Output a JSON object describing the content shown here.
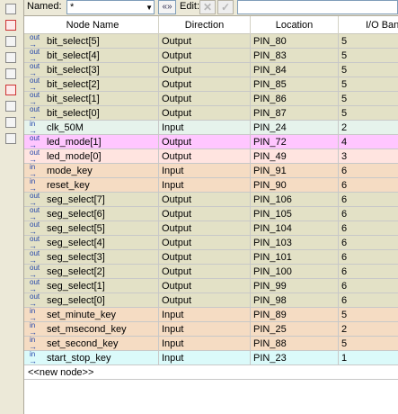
{
  "toolbar": {
    "named_label": "Named:",
    "named_value": "*",
    "combo_arrow": "▼",
    "expand_glyph": "«»",
    "edit_label": "Edit:",
    "x_glyph": "✕",
    "check_glyph": "✓"
  },
  "columns": [
    "Node Name",
    "Direction",
    "Location",
    "I/O Bank"
  ],
  "colors": {
    "output_row": "#e3e1c6",
    "input_row": "#f5dcc3",
    "selected_row": "#ffc6ff",
    "led_row": "#ffe4e0",
    "clk_row": "#e6f3ec",
    "last_row": "#dbfafa"
  },
  "rows": [
    {
      "dir_icon": "out",
      "name": "bit_select[5]",
      "direction": "Output",
      "location": "PIN_80",
      "bank": "5"
    },
    {
      "dir_icon": "out",
      "name": "bit_select[4]",
      "direction": "Output",
      "location": "PIN_83",
      "bank": "5"
    },
    {
      "dir_icon": "out",
      "name": "bit_select[3]",
      "direction": "Output",
      "location": "PIN_84",
      "bank": "5"
    },
    {
      "dir_icon": "out",
      "name": "bit_select[2]",
      "direction": "Output",
      "location": "PIN_85",
      "bank": "5"
    },
    {
      "dir_icon": "out",
      "name": "bit_select[1]",
      "direction": "Output",
      "location": "PIN_86",
      "bank": "5"
    },
    {
      "dir_icon": "out",
      "name": "bit_select[0]",
      "direction": "Output",
      "location": "PIN_87",
      "bank": "5"
    },
    {
      "dir_icon": "in",
      "name": "clk_50M",
      "direction": "Input",
      "location": "PIN_24",
      "bank": "2"
    },
    {
      "dir_icon": "out",
      "name": "led_mode[1]",
      "direction": "Output",
      "location": "PIN_72",
      "bank": "4"
    },
    {
      "dir_icon": "out",
      "name": "led_mode[0]",
      "direction": "Output",
      "location": "PIN_49",
      "bank": "3"
    },
    {
      "dir_icon": "in",
      "name": "mode_key",
      "direction": "Input",
      "location": "PIN_91",
      "bank": "6"
    },
    {
      "dir_icon": "in",
      "name": "reset_key",
      "direction": "Input",
      "location": "PIN_90",
      "bank": "6"
    },
    {
      "dir_icon": "out",
      "name": "seg_select[7]",
      "direction": "Output",
      "location": "PIN_106",
      "bank": "6"
    },
    {
      "dir_icon": "out",
      "name": "seg_select[6]",
      "direction": "Output",
      "location": "PIN_105",
      "bank": "6"
    },
    {
      "dir_icon": "out",
      "name": "seg_select[5]",
      "direction": "Output",
      "location": "PIN_104",
      "bank": "6"
    },
    {
      "dir_icon": "out",
      "name": "seg_select[4]",
      "direction": "Output",
      "location": "PIN_103",
      "bank": "6"
    },
    {
      "dir_icon": "out",
      "name": "seg_select[3]",
      "direction": "Output",
      "location": "PIN_101",
      "bank": "6"
    },
    {
      "dir_icon": "out",
      "name": "seg_select[2]",
      "direction": "Output",
      "location": "PIN_100",
      "bank": "6"
    },
    {
      "dir_icon": "out",
      "name": "seg_select[1]",
      "direction": "Output",
      "location": "PIN_99",
      "bank": "6"
    },
    {
      "dir_icon": "out",
      "name": "seg_select[0]",
      "direction": "Output",
      "location": "PIN_98",
      "bank": "6"
    },
    {
      "dir_icon": "in",
      "name": "set_minute_key",
      "direction": "Input",
      "location": "PIN_89",
      "bank": "5"
    },
    {
      "dir_icon": "in",
      "name": "set_msecond_key",
      "direction": "Input",
      "location": "PIN_25",
      "bank": "2"
    },
    {
      "dir_icon": "in",
      "name": "set_second_key",
      "direction": "Input",
      "location": "PIN_88",
      "bank": "5"
    },
    {
      "dir_icon": "in",
      "name": "start_stop_key",
      "direction": "Input",
      "location": "PIN_23",
      "bank": "1"
    }
  ],
  "new_node_text": "<<new node>>"
}
